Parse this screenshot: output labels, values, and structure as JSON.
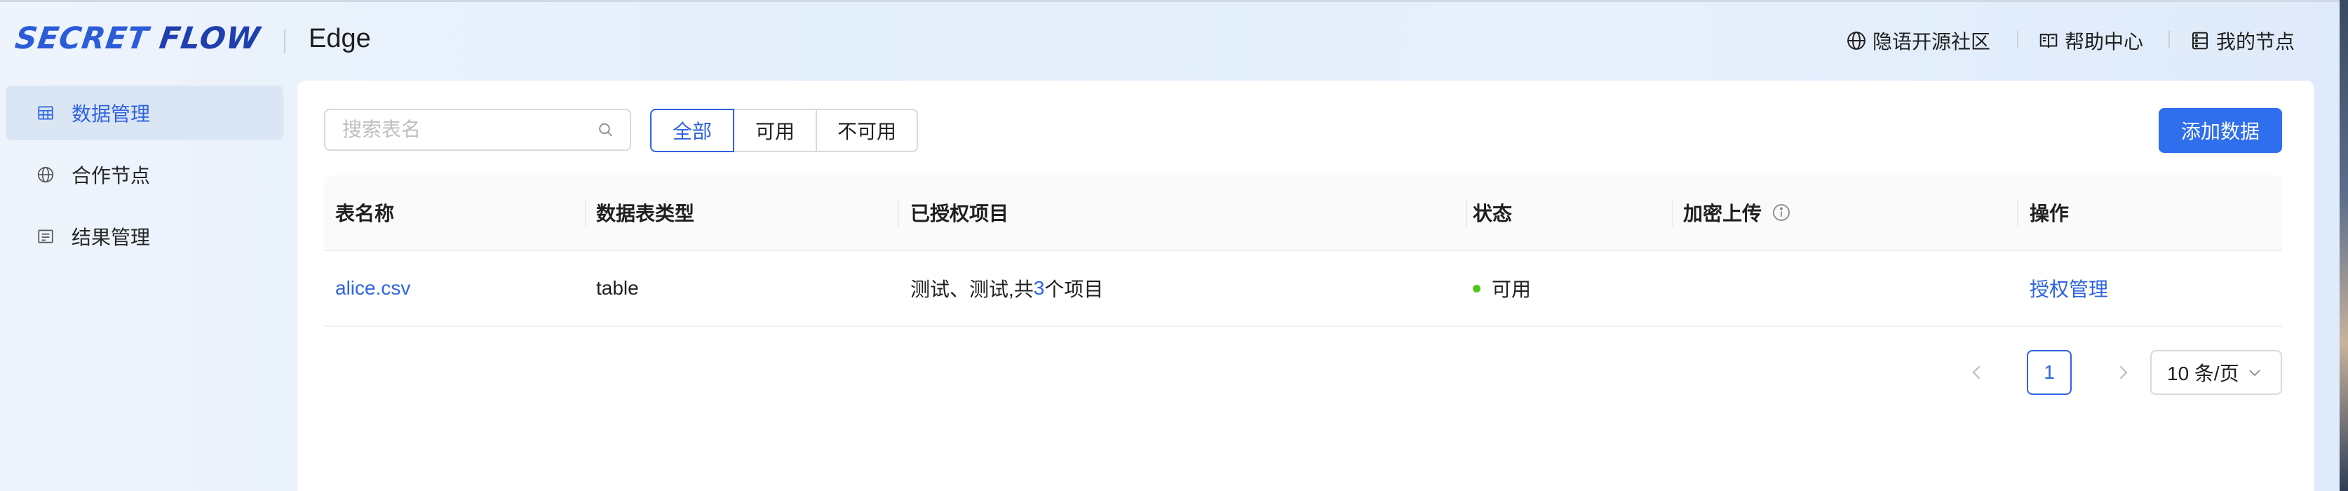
{
  "header": {
    "logo_part1": "SECRET",
    "logo_part2": "FLOW",
    "product": "Edge",
    "nav": [
      {
        "label": "隐语开源社区",
        "icon": "globe-icon"
      },
      {
        "label": "帮助中心",
        "icon": "book-icon"
      },
      {
        "label": "我的节点",
        "icon": "node-icon"
      }
    ]
  },
  "sidebar": {
    "items": [
      {
        "label": "数据管理",
        "icon": "table-icon",
        "active": true
      },
      {
        "label": "合作节点",
        "icon": "globe-icon"
      },
      {
        "label": "结果管理",
        "icon": "result-icon"
      }
    ]
  },
  "toolbar": {
    "search_placeholder": "搜索表名",
    "filters": [
      "全部",
      "可用",
      "不可用"
    ],
    "active_filter": "全部",
    "add_label": "添加数据"
  },
  "table": {
    "columns": [
      "表名称",
      "数据表类型",
      "已授权项目",
      "状态",
      "加密上传",
      "操作"
    ],
    "rows": [
      {
        "name": "alice.csv",
        "type": "table",
        "projects_prefix": "测试、测试,共",
        "projects_count": "3",
        "projects_suffix": "个项目",
        "status": "可用",
        "encrypted": "",
        "action": "授权管理"
      }
    ]
  },
  "pagination": {
    "current_page": "1",
    "page_size": "10 条/页"
  },
  "colors": {
    "primary": "#2f63e0",
    "button": "#2f6fed",
    "status_ok": "#52c41a"
  }
}
